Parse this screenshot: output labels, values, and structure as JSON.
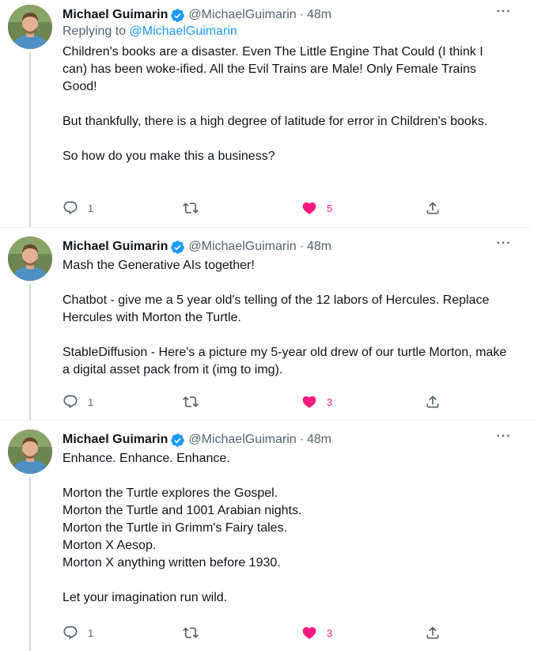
{
  "colors": {
    "accent": "#1d9bf0",
    "like": "#f91880",
    "secondary_text": "#536471",
    "primary_text": "#0f1419",
    "thread_line": "#cfd9de"
  },
  "tweets": [
    {
      "author_name": "Michael Guimarin",
      "handle": "@MichaelGuimarin",
      "separator": "·",
      "time": "48m",
      "more_icon": "more-horizontal-icon",
      "reply_prefix": "Replying to ",
      "reply_handle": "@MichaelGuimarin",
      "paragraphs": [
        "Children's books are a disaster. Even The Little Engine That Could (I think I can) has been woke-ified. All the Evil Trains are Male! Only Female Trains Good!",
        "But thankfully, there is a high degree of latitude for error in Children's books.",
        "So how do you make this a business?"
      ],
      "reply_count": "1",
      "retweet_count": "",
      "like_count": "5",
      "liked": true
    },
    {
      "author_name": "Michael Guimarin",
      "handle": "@MichaelGuimarin",
      "separator": "·",
      "time": "48m",
      "paragraphs": [
        "Mash the Generative AIs together!",
        "Chatbot - give me a 5 year old's telling of the 12 labors of Hercules. Replace Hercules with Morton the Turtle.",
        "StableDiffusion - Here's a picture my 5-year old drew of our turtle Morton, make a digital asset pack from it (img to img)."
      ],
      "reply_count": "1",
      "retweet_count": "",
      "like_count": "3",
      "liked": true
    },
    {
      "author_name": "Michael Guimarin",
      "handle": "@MichaelGuimarin",
      "separator": "·",
      "time": "48m",
      "paragraphs": [
        "Enhance. Enhance. Enhance.",
        "Morton the Turtle explores the Gospel.\nMorton the Turtle and 1001 Arabian nights.\nMorton the Turtle in Grimm's Fairy tales.\nMorton X Aesop.\nMorton X anything written before 1930.",
        "Let your imagination run wild."
      ],
      "reply_count": "1",
      "retweet_count": "",
      "like_count": "3",
      "liked": true
    }
  ]
}
